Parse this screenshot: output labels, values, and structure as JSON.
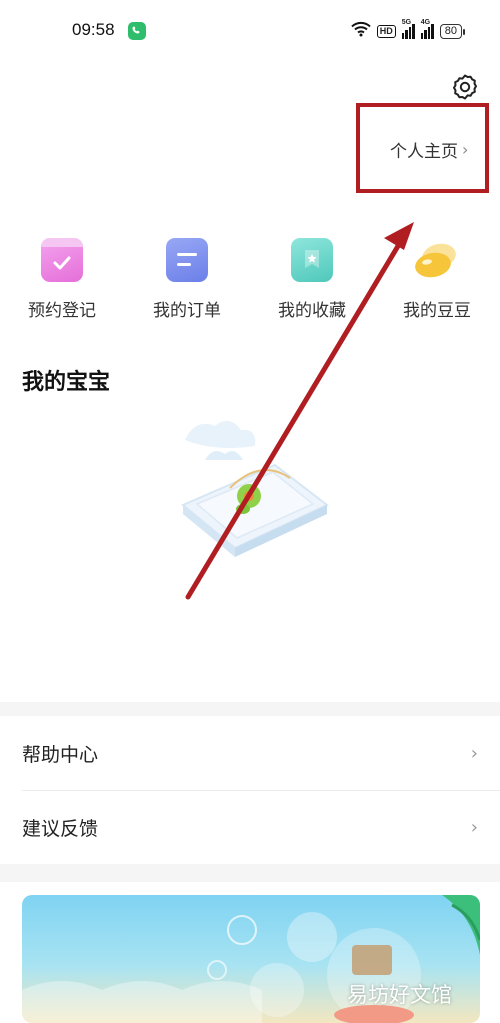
{
  "status_bar": {
    "time": "09:58",
    "hd_label": "HD",
    "signal1_gen": "5G",
    "signal2_gen": "4G",
    "battery": "80"
  },
  "header": {
    "profile_link": "个人主页",
    "chevron": "›"
  },
  "quick_actions": [
    {
      "label": "预约登记",
      "icon": "calendar-check-icon",
      "color": "#ee7ee0"
    },
    {
      "label": "我的订单",
      "icon": "order-list-icon",
      "color": "#7c8ff0"
    },
    {
      "label": "我的收藏",
      "icon": "star-bookmark-icon",
      "color": "#5fd5c8"
    },
    {
      "label": "我的豆豆",
      "icon": "bean-icon",
      "color": "#f8c843"
    }
  ],
  "baby": {
    "title": "我的宝宝"
  },
  "menu": [
    {
      "label": "帮助中心",
      "chevron": "›"
    },
    {
      "label": "建议反馈",
      "chevron": "›"
    }
  ],
  "banner": {
    "watermark": "易坊好文馆"
  },
  "colors": {
    "annotation_red": "#b01e22",
    "call_green": "#2ebd6b"
  }
}
